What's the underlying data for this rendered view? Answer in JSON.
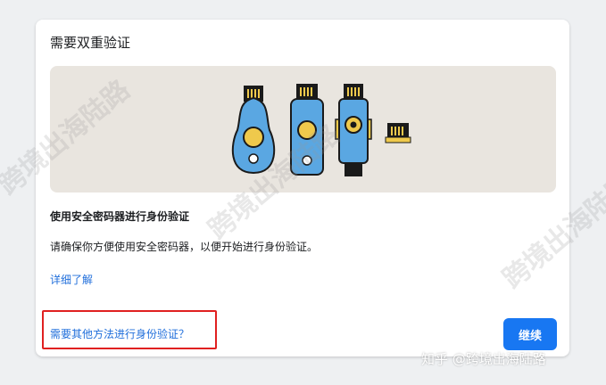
{
  "dialog": {
    "title": "需要双重验证",
    "heading": "使用安全密码器进行身份验证",
    "description": "请确保你方便使用安全密码器，以便开始进行身份验证。",
    "learn_more": "详细了解",
    "other_method": "需要其他方法进行身份验证？",
    "continue_label": "继续"
  },
  "watermark": {
    "text": "跨境出海陆路",
    "credit": "知乎 @跨境出海陆路"
  },
  "colors": {
    "key_blue": "#5aa7e2",
    "key_gold": "#efc94c",
    "accent": "#1877f2",
    "link": "#216fdb",
    "highlight": "#e02020"
  }
}
